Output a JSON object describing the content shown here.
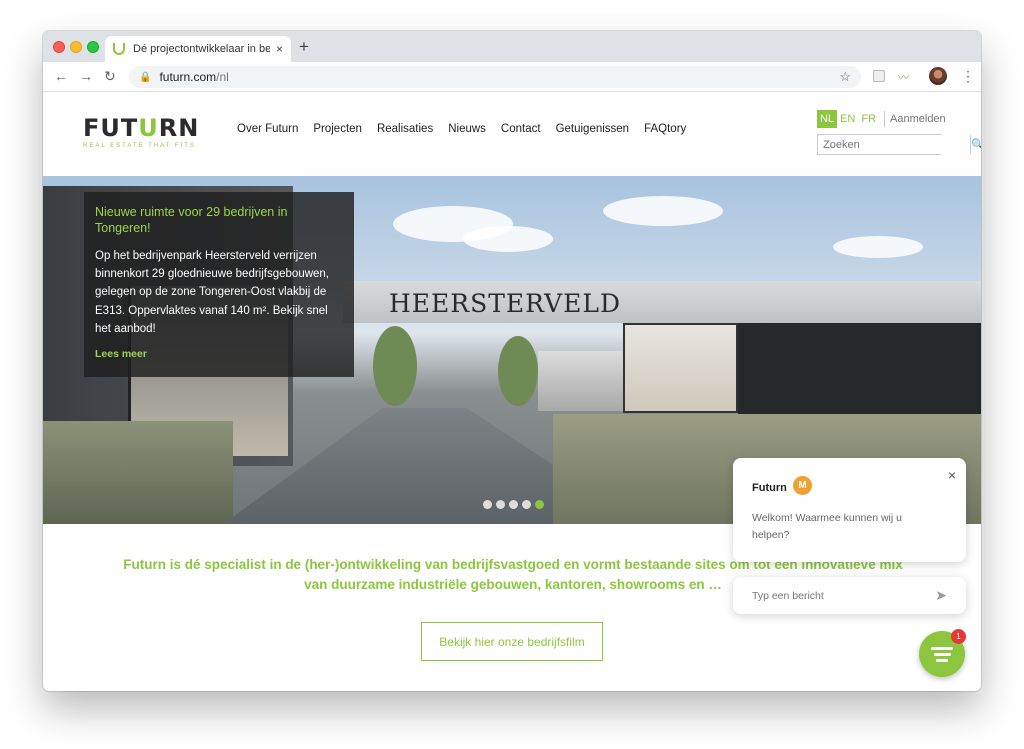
{
  "browser": {
    "tab_title": "Dé projectontwikkelaar in bedrijfsvastgoed",
    "tab_close": "×",
    "new_tab": "+",
    "back": "←",
    "forward": "→",
    "reload": "↻",
    "url_host": "futurn.com",
    "url_path": "/nl",
    "lock": "🔒",
    "star": "☆",
    "menu": "⋮"
  },
  "site": {
    "logo": {
      "prefix": "FUT",
      "u": "U",
      "suffix": "RN",
      "tagline": "REAL ESTATE THAT FITS"
    },
    "nav": [
      "Over Futurn",
      "Projecten",
      "Realisaties",
      "Nieuws",
      "Contact",
      "Getuigenissen",
      "FAQtory"
    ],
    "languages": {
      "nl": "NL",
      "en": "EN",
      "fr": "FR",
      "active": "NL"
    },
    "login": "Aanmelden",
    "search": {
      "placeholder": "Zoeken",
      "icon": "🔍"
    },
    "hero": {
      "sign": "HEERSTERVELD",
      "title": "Nieuwe ruimte voor 29 bedrijven in Tongeren!",
      "body": "Op het bedrijvenpark Heersterveld verrijzen binnenkort 29 gloednieuwe bedrijfsgebouwen, gelegen op de zone Tongeren-Oost vlakbij de E313. Oppervlaktes vanaf 140 m². Bekijk snel het aanbod!",
      "more": "Lees meer",
      "slides": 5,
      "active_slide": 5
    },
    "tagline": "Futurn is dé specialist in de (her-)ontwikkeling van bedrijfsvastgoed en vormt bestaande sites om tot een innovatieve mix van duurzame industriële gebouwen, kantoren, showrooms en …",
    "film_button": "Bekijk hier onze bedrijfsfilm"
  },
  "chat": {
    "agent_name": "Futurn",
    "avatar_initial": "M",
    "close": "×",
    "message": "Welkom! Waarmee kunnen wij u helpen?",
    "input_placeholder": "Typ een bericht",
    "send_icon": "➤",
    "badge_count": "1"
  },
  "colors": {
    "brand_green": "#8cc63f",
    "dark": "#2b2b2b",
    "badge_red": "#e53935"
  }
}
